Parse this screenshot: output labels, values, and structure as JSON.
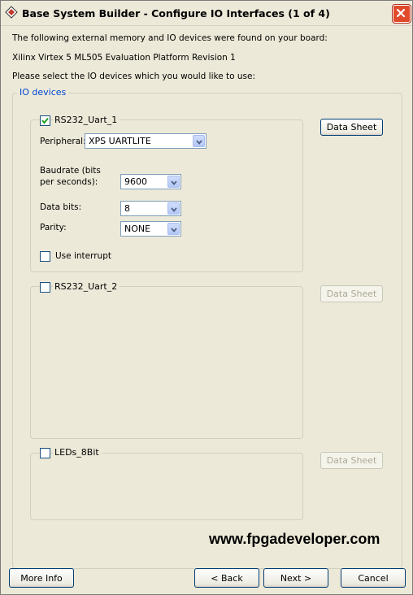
{
  "window": {
    "title": "Base System Builder - Configure IO Interfaces (1 of 4)"
  },
  "intro": {
    "line1": "The following external memory and IO devices were found on your board:",
    "board": "Xilinx Virtex 5 ML505 Evaluation Platform Revision 1",
    "line3": "Please select the IO devices which you would like to use:"
  },
  "io_group": {
    "legend": "IO devices"
  },
  "devices": [
    {
      "name": "RS232_Uart_1",
      "checked": true,
      "datasheet_label": "Data Sheet",
      "peripheral_label": "Peripheral:",
      "peripheral_value": "XPS UARTLITE",
      "baud_label_1": "Baudrate (bits",
      "baud_label_2": "per seconds):",
      "baud_value": "9600",
      "databits_label": "Data bits:",
      "databits_value": "8",
      "parity_label": "Parity:",
      "parity_value": "NONE",
      "interrupt_label": "Use interrupt",
      "interrupt_checked": false
    },
    {
      "name": "RS232_Uart_2",
      "checked": false,
      "datasheet_label": "Data Sheet"
    },
    {
      "name": "LEDs_8Bit",
      "checked": false,
      "datasheet_label": "Data Sheet"
    }
  ],
  "watermark": "www.fpgadeveloper.com",
  "footer": {
    "more_info": "More Info",
    "back": "< Back",
    "next": "Next >",
    "cancel": "Cancel"
  },
  "colors": {
    "window_bg": "#ece9d8",
    "legend_blue": "#0046d5",
    "close_red": "#e04a2a"
  }
}
